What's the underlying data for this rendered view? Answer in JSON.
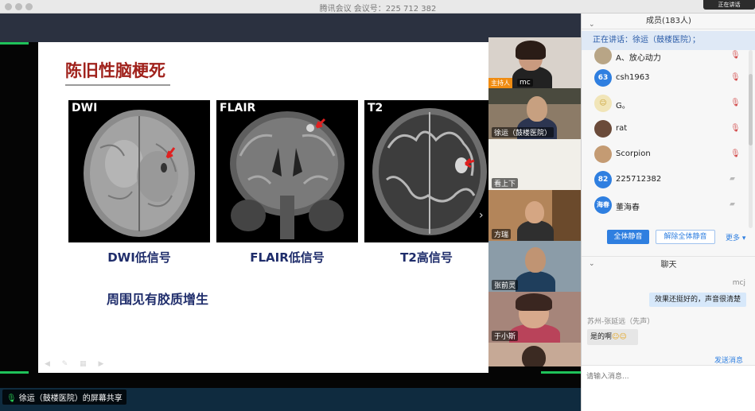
{
  "window": {
    "title": "腾讯会议 会议号：225 712 382"
  },
  "slide": {
    "title": "陈旧性脑梗死",
    "images": [
      {
        "label": "DWI",
        "caption": "DWI低信号"
      },
      {
        "label": "FLAIR",
        "caption": "FLAIR低信号"
      },
      {
        "label": "T2",
        "caption": "T2高信号"
      }
    ],
    "note": "周围见有胶质增生"
  },
  "videos": {
    "host_tag": "主持人",
    "tiles": [
      {
        "name": "mc"
      },
      {
        "name": "徐运（鼓楼医院）"
      },
      {
        "name": "看上下"
      },
      {
        "name": "方瑞"
      },
      {
        "name": "张前灵"
      },
      {
        "name": "于小斯"
      }
    ]
  },
  "status": {
    "share_text": "徐运（鼓楼医院）的屏幕共享"
  },
  "panel": {
    "members_title": "成员(183人)",
    "speaking": "正在讲话：徐运（鼓楼医院）；",
    "members": [
      {
        "name": "A、放心动力",
        "avatar": "",
        "color": "#b8a586",
        "mic": "mic-muted-icon"
      },
      {
        "name": "csh1963",
        "avatar": "63",
        "color": "#2f7fe0",
        "mic": "mic-muted-icon"
      },
      {
        "name": "G。",
        "avatar": "",
        "color": "#e6c64a",
        "mic": "mic-muted-icon"
      },
      {
        "name": "rat",
        "avatar": "",
        "color": "#6b4b3a",
        "mic": "mic-muted-icon"
      },
      {
        "name": "Scorpion",
        "avatar": "",
        "color": "#c49b73",
        "mic": "mic-muted-icon"
      },
      {
        "name": "225712382",
        "avatar": "82",
        "color": "#2f7fe0",
        "mic": "camera-off-icon"
      },
      {
        "name": "董海春",
        "avatar": "海春",
        "color": "#2f7fe0",
        "mic": "camera-off-icon"
      }
    ],
    "buttons": {
      "mute_all": "全体静音",
      "unmute_all": "解除全体静音",
      "more": "更多"
    },
    "chat": {
      "title": "聊天",
      "messages": [
        {
          "sender": "mcj",
          "text": "效果还挺好的，声音很清楚"
        },
        {
          "sender": "苏州-张延远（先声）",
          "text": "是的啊"
        }
      ],
      "send": "发送消息",
      "input_placeholder": "请输入消息..."
    },
    "top_tab": "正在讲话"
  }
}
